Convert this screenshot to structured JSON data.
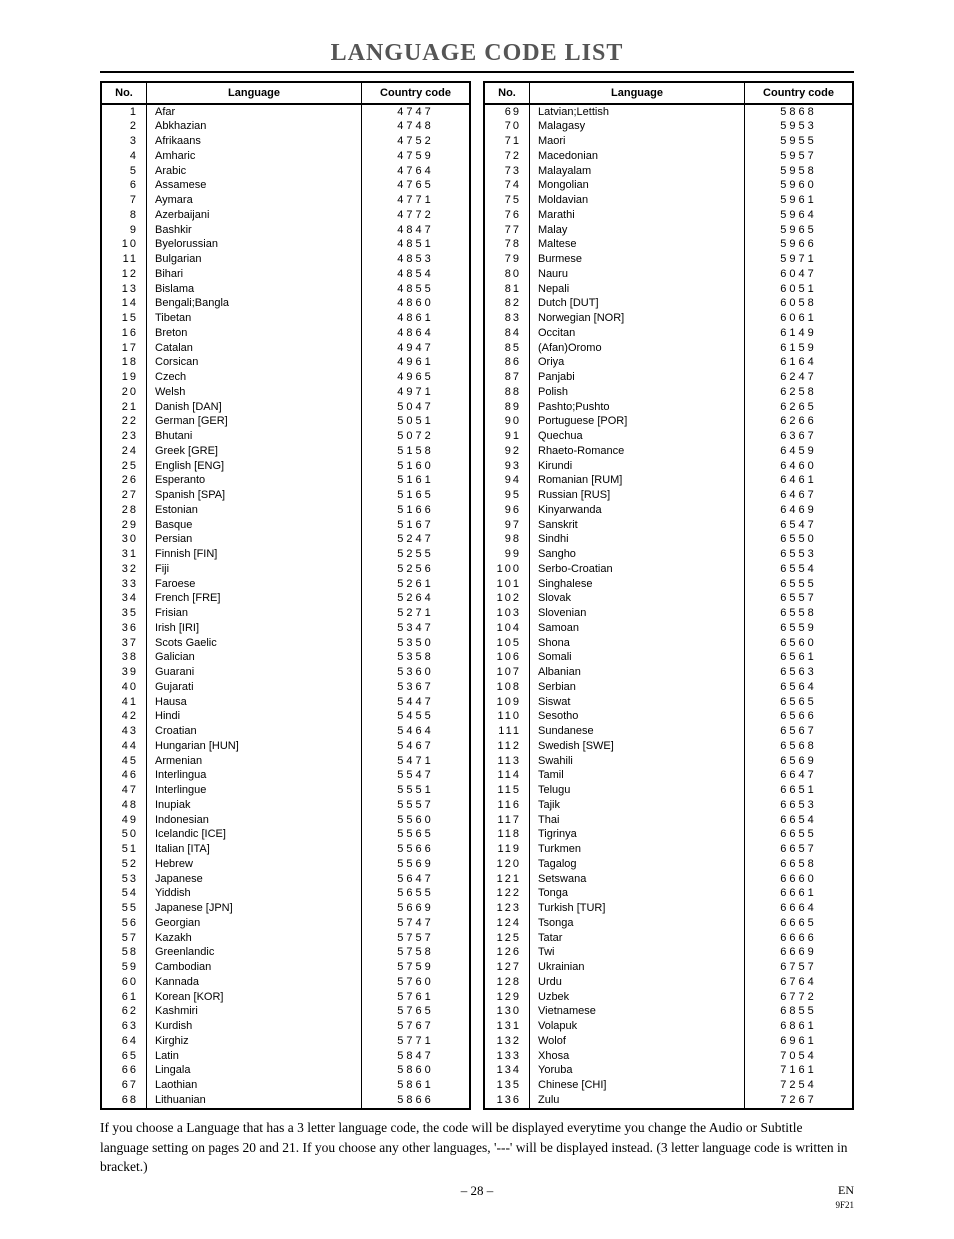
{
  "title": "LANGUAGE CODE LIST",
  "headers": {
    "no": "No.",
    "language": "Language",
    "code": "Country code"
  },
  "left": [
    {
      "n": "1",
      "l": "Afar",
      "c": "4747"
    },
    {
      "n": "2",
      "l": "Abkhazian",
      "c": "4748"
    },
    {
      "n": "3",
      "l": "Afrikaans",
      "c": "4752"
    },
    {
      "n": "4",
      "l": "Amharic",
      "c": "4759"
    },
    {
      "n": "5",
      "l": "Arabic",
      "c": "4764"
    },
    {
      "n": "6",
      "l": "Assamese",
      "c": "4765"
    },
    {
      "n": "7",
      "l": "Aymara",
      "c": "4771"
    },
    {
      "n": "8",
      "l": "Azerbaijani",
      "c": "4772"
    },
    {
      "n": "9",
      "l": "Bashkir",
      "c": "4847"
    },
    {
      "n": "10",
      "l": "Byelorussian",
      "c": "4851"
    },
    {
      "n": "11",
      "l": "Bulgarian",
      "c": "4853"
    },
    {
      "n": "12",
      "l": "Bihari",
      "c": "4854"
    },
    {
      "n": "13",
      "l": "Bislama",
      "c": "4855"
    },
    {
      "n": "14",
      "l": "Bengali;Bangla",
      "c": "4860"
    },
    {
      "n": "15",
      "l": "Tibetan",
      "c": "4861"
    },
    {
      "n": "16",
      "l": "Breton",
      "c": "4864"
    },
    {
      "n": "17",
      "l": "Catalan",
      "c": "4947"
    },
    {
      "n": "18",
      "l": "Corsican",
      "c": "4961"
    },
    {
      "n": "19",
      "l": "Czech",
      "c": "4965"
    },
    {
      "n": "20",
      "l": "Welsh",
      "c": "4971"
    },
    {
      "n": "21",
      "l": "Danish [DAN]",
      "c": "5047"
    },
    {
      "n": "22",
      "l": "German [GER]",
      "c": "5051"
    },
    {
      "n": "23",
      "l": "Bhutani",
      "c": "5072"
    },
    {
      "n": "24",
      "l": "Greek [GRE]",
      "c": "5158"
    },
    {
      "n": "25",
      "l": "English [ENG]",
      "c": "5160"
    },
    {
      "n": "26",
      "l": "Esperanto",
      "c": "5161"
    },
    {
      "n": "27",
      "l": "Spanish [SPA]",
      "c": "5165"
    },
    {
      "n": "28",
      "l": "Estonian",
      "c": "5166"
    },
    {
      "n": "29",
      "l": "Basque",
      "c": "5167"
    },
    {
      "n": "30",
      "l": "Persian",
      "c": "5247"
    },
    {
      "n": "31",
      "l": "Finnish [FIN]",
      "c": "5255"
    },
    {
      "n": "32",
      "l": "Fiji",
      "c": "5256"
    },
    {
      "n": "33",
      "l": "Faroese",
      "c": "5261"
    },
    {
      "n": "34",
      "l": "French [FRE]",
      "c": "5264"
    },
    {
      "n": "35",
      "l": "Frisian",
      "c": "5271"
    },
    {
      "n": "36",
      "l": "Irish [IRI]",
      "c": "5347"
    },
    {
      "n": "37",
      "l": "Scots Gaelic",
      "c": "5350"
    },
    {
      "n": "38",
      "l": "Galician",
      "c": "5358"
    },
    {
      "n": "39",
      "l": "Guarani",
      "c": "5360"
    },
    {
      "n": "40",
      "l": "Gujarati",
      "c": "5367"
    },
    {
      "n": "41",
      "l": "Hausa",
      "c": "5447"
    },
    {
      "n": "42",
      "l": "Hindi",
      "c": "5455"
    },
    {
      "n": "43",
      "l": "Croatian",
      "c": "5464"
    },
    {
      "n": "44",
      "l": "Hungarian [HUN]",
      "c": "5467"
    },
    {
      "n": "45",
      "l": "Armenian",
      "c": "5471"
    },
    {
      "n": "46",
      "l": "Interlingua",
      "c": "5547"
    },
    {
      "n": "47",
      "l": "Interlingue",
      "c": "5551"
    },
    {
      "n": "48",
      "l": "Inupiak",
      "c": "5557"
    },
    {
      "n": "49",
      "l": "Indonesian",
      "c": "5560"
    },
    {
      "n": "50",
      "l": "Icelandic [ICE]",
      "c": "5565"
    },
    {
      "n": "51",
      "l": "Italian [ITA]",
      "c": "5566"
    },
    {
      "n": "52",
      "l": "Hebrew",
      "c": "5569"
    },
    {
      "n": "53",
      "l": "Japanese",
      "c": "5647"
    },
    {
      "n": "54",
      "l": "Yiddish",
      "c": "5655"
    },
    {
      "n": "55",
      "l": "Japanese [JPN]",
      "c": "5669"
    },
    {
      "n": "56",
      "l": "Georgian",
      "c": "5747"
    },
    {
      "n": "57",
      "l": "Kazakh",
      "c": "5757"
    },
    {
      "n": "58",
      "l": "Greenlandic",
      "c": "5758"
    },
    {
      "n": "59",
      "l": "Cambodian",
      "c": "5759"
    },
    {
      "n": "60",
      "l": "Kannada",
      "c": "5760"
    },
    {
      "n": "61",
      "l": "Korean [KOR]",
      "c": "5761"
    },
    {
      "n": "62",
      "l": "Kashmiri",
      "c": "5765"
    },
    {
      "n": "63",
      "l": "Kurdish",
      "c": "5767"
    },
    {
      "n": "64",
      "l": "Kirghiz",
      "c": "5771"
    },
    {
      "n": "65",
      "l": "Latin",
      "c": "5847"
    },
    {
      "n": "66",
      "l": "Lingala",
      "c": "5860"
    },
    {
      "n": "67",
      "l": "Laothian",
      "c": "5861"
    },
    {
      "n": "68",
      "l": "Lithuanian",
      "c": "5866"
    }
  ],
  "right": [
    {
      "n": "69",
      "l": "Latvian;Lettish",
      "c": "5868"
    },
    {
      "n": "70",
      "l": "Malagasy",
      "c": "5953"
    },
    {
      "n": "71",
      "l": "Maori",
      "c": "5955"
    },
    {
      "n": "72",
      "l": "Macedonian",
      "c": "5957"
    },
    {
      "n": "73",
      "l": "Malayalam",
      "c": "5958"
    },
    {
      "n": "74",
      "l": "Mongolian",
      "c": "5960"
    },
    {
      "n": "75",
      "l": "Moldavian",
      "c": "5961"
    },
    {
      "n": "76",
      "l": "Marathi",
      "c": "5964"
    },
    {
      "n": "77",
      "l": "Malay",
      "c": "5965"
    },
    {
      "n": "78",
      "l": "Maltese",
      "c": "5966"
    },
    {
      "n": "79",
      "l": "Burmese",
      "c": "5971"
    },
    {
      "n": "80",
      "l": "Nauru",
      "c": "6047"
    },
    {
      "n": "81",
      "l": "Nepali",
      "c": "6051"
    },
    {
      "n": "82",
      "l": "Dutch [DUT]",
      "c": "6058"
    },
    {
      "n": "83",
      "l": "Norwegian [NOR]",
      "c": "6061"
    },
    {
      "n": "84",
      "l": "Occitan",
      "c": "6149"
    },
    {
      "n": "85",
      "l": "(Afan)Oromo",
      "c": "6159"
    },
    {
      "n": "86",
      "l": "Oriya",
      "c": "6164"
    },
    {
      "n": "87",
      "l": "Panjabi",
      "c": "6247"
    },
    {
      "n": "88",
      "l": "Polish",
      "c": "6258"
    },
    {
      "n": "89",
      "l": "Pashto;Pushto",
      "c": "6265"
    },
    {
      "n": "90",
      "l": "Portuguese [POR]",
      "c": "6266"
    },
    {
      "n": "91",
      "l": "Quechua",
      "c": "6367"
    },
    {
      "n": "92",
      "l": "Rhaeto-Romance",
      "c": "6459"
    },
    {
      "n": "93",
      "l": "Kirundi",
      "c": "6460"
    },
    {
      "n": "94",
      "l": "Romanian [RUM]",
      "c": "6461"
    },
    {
      "n": "95",
      "l": "Russian [RUS]",
      "c": "6467"
    },
    {
      "n": "96",
      "l": "Kinyarwanda",
      "c": "6469"
    },
    {
      "n": "97",
      "l": "Sanskrit",
      "c": "6547"
    },
    {
      "n": "98",
      "l": "Sindhi",
      "c": "6550"
    },
    {
      "n": "99",
      "l": "Sangho",
      "c": "6553"
    },
    {
      "n": "100",
      "l": "Serbo-Croatian",
      "c": "6554"
    },
    {
      "n": "101",
      "l": "Singhalese",
      "c": "6555"
    },
    {
      "n": "102",
      "l": "Slovak",
      "c": "6557"
    },
    {
      "n": "103",
      "l": "Slovenian",
      "c": "6558"
    },
    {
      "n": "104",
      "l": "Samoan",
      "c": "6559"
    },
    {
      "n": "105",
      "l": "Shona",
      "c": "6560"
    },
    {
      "n": "106",
      "l": "Somali",
      "c": "6561"
    },
    {
      "n": "107",
      "l": "Albanian",
      "c": "6563"
    },
    {
      "n": "108",
      "l": "Serbian",
      "c": "6564"
    },
    {
      "n": "109",
      "l": "Siswat",
      "c": "6565"
    },
    {
      "n": "110",
      "l": "Sesotho",
      "c": "6566"
    },
    {
      "n": "111",
      "l": "Sundanese",
      "c": "6567"
    },
    {
      "n": "112",
      "l": "Swedish [SWE]",
      "c": "6568"
    },
    {
      "n": "113",
      "l": "Swahili",
      "c": "6569"
    },
    {
      "n": "114",
      "l": "Tamil",
      "c": "6647"
    },
    {
      "n": "115",
      "l": "Telugu",
      "c": "6651"
    },
    {
      "n": "116",
      "l": "Tajik",
      "c": "6653"
    },
    {
      "n": "117",
      "l": "Thai",
      "c": "6654"
    },
    {
      "n": "118",
      "l": "Tigrinya",
      "c": "6655"
    },
    {
      "n": "119",
      "l": "Turkmen",
      "c": "6657"
    },
    {
      "n": "120",
      "l": "Tagalog",
      "c": "6658"
    },
    {
      "n": "121",
      "l": "Setswana",
      "c": "6660"
    },
    {
      "n": "122",
      "l": "Tonga",
      "c": "6661"
    },
    {
      "n": "123",
      "l": "Turkish [TUR]",
      "c": "6664"
    },
    {
      "n": "124",
      "l": "Tsonga",
      "c": "6665"
    },
    {
      "n": "125",
      "l": "Tatar",
      "c": "6666"
    },
    {
      "n": "126",
      "l": "Twi",
      "c": "6669"
    },
    {
      "n": "127",
      "l": "Ukrainian",
      "c": "6757"
    },
    {
      "n": "128",
      "l": "Urdu",
      "c": "6764"
    },
    {
      "n": "129",
      "l": "Uzbek",
      "c": "6772"
    },
    {
      "n": "130",
      "l": "Vietnamese",
      "c": "6855"
    },
    {
      "n": "131",
      "l": "Volapuk",
      "c": "6861"
    },
    {
      "n": "132",
      "l": "Wolof",
      "c": "6961"
    },
    {
      "n": "133",
      "l": "Xhosa",
      "c": "7054"
    },
    {
      "n": "134",
      "l": "Yoruba",
      "c": "7161"
    },
    {
      "n": "135",
      "l": "Chinese [CHI]",
      "c": "7254"
    },
    {
      "n": "136",
      "l": "Zulu",
      "c": "7267"
    }
  ],
  "footnote": "If you choose a Language that has a 3 letter language code, the code will be displayed everytime you change the Audio or Subtitle language setting on pages 20 and 21. If you choose any other languages, '---' will be displayed instead. (3 letter language code is written in bracket.)",
  "page": "– 28 –",
  "page_lang": "EN",
  "page_rev": "9F21"
}
